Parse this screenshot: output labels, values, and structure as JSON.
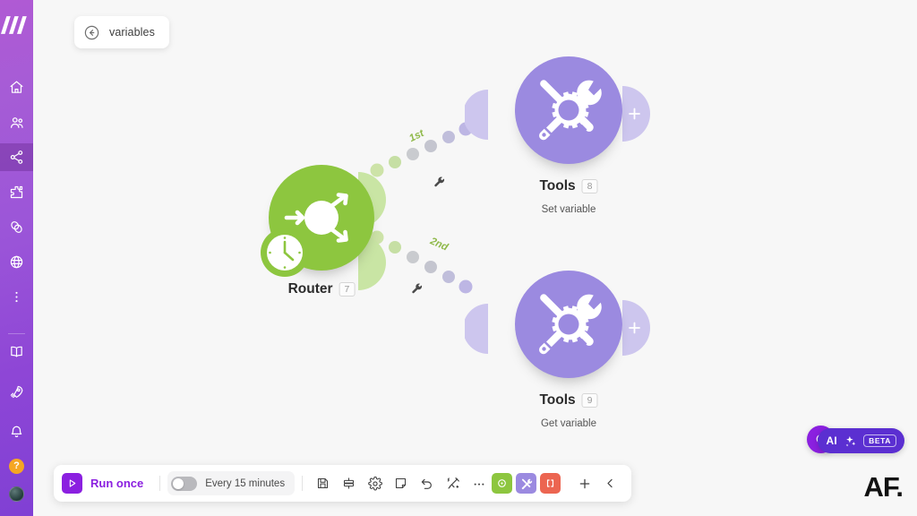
{
  "app": {
    "brand_logo": "make-logo",
    "canvas_background": "#f7f7f7",
    "sidebar_gradient_from": "#b05ad4",
    "sidebar_gradient_to": "#8040d4"
  },
  "sidebar": {
    "items_top": [
      {
        "icon": "home-icon",
        "name": "home",
        "active": false
      },
      {
        "icon": "users-icon",
        "name": "teams",
        "active": false
      },
      {
        "icon": "share-nodes-icon",
        "name": "scenarios",
        "active": true
      },
      {
        "icon": "puzzle-icon",
        "name": "templates",
        "active": false
      },
      {
        "icon": "link-chain-icon",
        "name": "connections",
        "active": false
      },
      {
        "icon": "globe-icon",
        "name": "webhooks",
        "active": false
      },
      {
        "icon": "more-vertical-icon",
        "name": "more",
        "active": false
      }
    ],
    "items_bottom": [
      {
        "icon": "book-icon",
        "name": "docs"
      },
      {
        "icon": "rocket-icon",
        "name": "whats-new"
      },
      {
        "icon": "bell-icon",
        "name": "notifications"
      },
      {
        "icon": "help-circle-icon",
        "name": "help",
        "label": "?"
      },
      {
        "icon": "avatar-icon",
        "name": "profile"
      }
    ]
  },
  "breadcrumb": {
    "back_icon": "circle-arrow-left-icon",
    "label": "variables"
  },
  "flow": {
    "nodes": [
      {
        "id": "router",
        "title": "Router",
        "badge": "7",
        "subtitle": "",
        "icon": "router-arrows-icon",
        "color": "#8dc63f",
        "clock_badge": "clock-icon"
      },
      {
        "id": "tools-set",
        "title": "Tools",
        "badge": "8",
        "subtitle": "Set variable",
        "icon": "tools-gear-icon",
        "color": "#9b8ae0",
        "add_handle": "+"
      },
      {
        "id": "tools-get",
        "title": "Tools",
        "badge": "9",
        "subtitle": "Get variable",
        "icon": "tools-gear-icon",
        "color": "#9b8ae0",
        "add_handle": "+"
      }
    ],
    "connectors": [
      {
        "from": "router",
        "to": "tools-set",
        "order_label": "1st",
        "wrench": "wrench-icon"
      },
      {
        "from": "router",
        "to": "tools-get",
        "order_label": "2nd",
        "wrench": "wrench-icon"
      }
    ]
  },
  "toolbar": {
    "run_label": "Run once",
    "run_icon": "play-icon",
    "schedule_label": "Every 15 minutes",
    "schedule_enabled": false,
    "icons": [
      {
        "name": "save-icon",
        "label": ""
      },
      {
        "name": "align-icon",
        "label": ""
      },
      {
        "name": "settings-gear-icon",
        "label": ""
      },
      {
        "name": "note-icon",
        "label": ""
      },
      {
        "name": "undo-icon",
        "label": ""
      },
      {
        "name": "auto-align-icon",
        "label": ""
      },
      {
        "name": "more-horizontal-icon",
        "label": ""
      }
    ],
    "color_buttons": [
      {
        "name": "scheduling-button",
        "color": "#8dc63f",
        "icon": "clock-dot-icon"
      },
      {
        "name": "tools-button",
        "color": "#9b8ae0",
        "icon": "tools-icon"
      },
      {
        "name": "brackets-button",
        "color": "#ec6551",
        "icon": "brackets-icon"
      }
    ],
    "add_icon": "plus-icon",
    "collapse_icon": "chevron-left-icon"
  },
  "assistant": {
    "bulb_icon": "lightbulb-icon",
    "ai_label": "AI",
    "sparkle_icon": "sparkles-icon",
    "beta_label": "BETA"
  },
  "watermark": {
    "text": "AF."
  }
}
